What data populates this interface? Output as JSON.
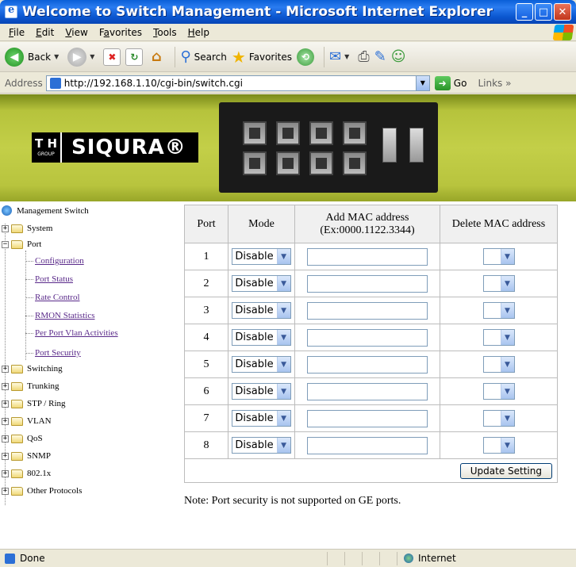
{
  "window": {
    "title": "Welcome to Switch Management - Microsoft Internet Explorer",
    "min": "_",
    "max": "□",
    "close": "✕"
  },
  "menubar": {
    "items": [
      {
        "pre": "",
        "u": "F",
        "post": "ile"
      },
      {
        "pre": "",
        "u": "E",
        "post": "dit"
      },
      {
        "pre": "",
        "u": "V",
        "post": "iew"
      },
      {
        "pre": "F",
        "u": "a",
        "post": "vorites"
      },
      {
        "pre": "",
        "u": "T",
        "post": "ools"
      },
      {
        "pre": "",
        "u": "H",
        "post": "elp"
      }
    ]
  },
  "toolbar": {
    "back": "Back",
    "search": "Search",
    "favorites": "Favorites"
  },
  "address": {
    "label": "Address",
    "url": "http://192.168.1.10/cgi-bin/switch.cgi",
    "go": "Go",
    "links": "Links"
  },
  "banner": {
    "logo_group": "T H",
    "logo_group_sub": "GROUP",
    "logo_name": "SIQURA®"
  },
  "sidebar": {
    "root": "Management Switch",
    "system": "System",
    "port": "Port",
    "port_children": [
      "Configuration",
      "Port Status",
      "Rate Control",
      "RMON Statistics",
      "Per Port Vlan Activities",
      "Port Security"
    ],
    "others": [
      "Switching",
      "Trunking",
      "STP / Ring",
      "VLAN",
      "QoS",
      "SNMP",
      "802.1x",
      "Other Protocols"
    ]
  },
  "table": {
    "headers": {
      "port": "Port",
      "mode": "Mode",
      "add_mac": "Add MAC address",
      "add_mac_hint": "(Ex:0000.1122.3344)",
      "delete_mac": "Delete MAC address"
    },
    "rows": [
      {
        "port": "1",
        "mode": "Disable",
        "add_mac": "",
        "delete_mac": ""
      },
      {
        "port": "2",
        "mode": "Disable",
        "add_mac": "",
        "delete_mac": ""
      },
      {
        "port": "3",
        "mode": "Disable",
        "add_mac": "",
        "delete_mac": ""
      },
      {
        "port": "4",
        "mode": "Disable",
        "add_mac": "",
        "delete_mac": ""
      },
      {
        "port": "5",
        "mode": "Disable",
        "add_mac": "",
        "delete_mac": ""
      },
      {
        "port": "6",
        "mode": "Disable",
        "add_mac": "",
        "delete_mac": ""
      },
      {
        "port": "7",
        "mode": "Disable",
        "add_mac": "",
        "delete_mac": ""
      },
      {
        "port": "8",
        "mode": "Disable",
        "add_mac": "",
        "delete_mac": ""
      }
    ],
    "update_button": "Update Setting"
  },
  "note": "Note: Port security is not supported on GE ports.",
  "status": {
    "text": "Done",
    "zone": "Internet"
  },
  "icons": {
    "back": "back-arrow-icon",
    "forward": "forward-arrow-icon",
    "stop": "stop-icon",
    "refresh": "refresh-icon",
    "home": "home-icon",
    "search": "search-icon",
    "favorites": "star-icon",
    "history": "history-icon",
    "mail": "mail-icon",
    "print": "print-icon",
    "edit": "edit-icon",
    "messenger": "messenger-icon"
  }
}
